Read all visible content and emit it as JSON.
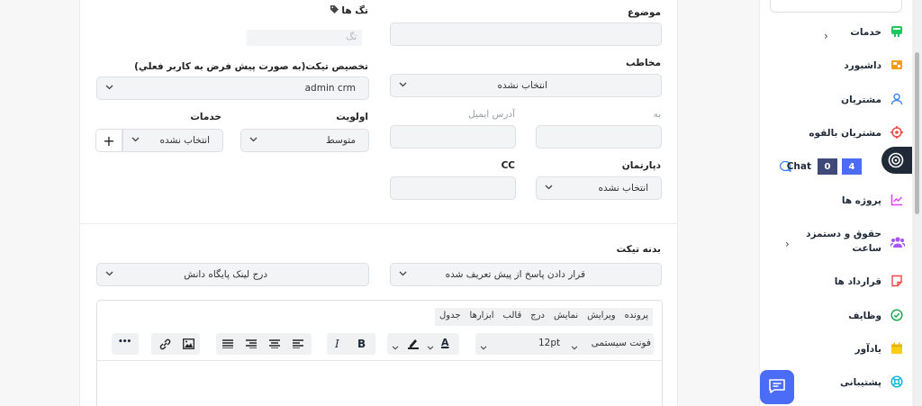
{
  "form": {
    "tags_label": "تگ ها",
    "tags_placeholder": "تگ",
    "subject_label": "موضوع",
    "subject_value": "",
    "assign_label": "تخصیص تیکت(به صورت پیش فرض به کاربر فعلي)",
    "assign_value": "admin crm",
    "contact_label": "مخاطب",
    "contact_value": "انتخاب نشده",
    "priority_label": "اولویت",
    "priority_value": "متوسط",
    "services_label": "خدمات",
    "services_value": "انتخاب نشده",
    "add_symbol": "+",
    "to_label": "به",
    "email_label": "آدرس ایمیل",
    "department_label": "دپارتمان",
    "department_value": "انتخاب نشده",
    "cc_label": "CC",
    "body_label": "بدنه تیکت",
    "predefined_reply_value": "قرار دادن پاسخ از پیش تعریف شده",
    "kb_link_value": "درج لینک پایگاه دانش"
  },
  "editor": {
    "menus": [
      "پرونده",
      "ویرایش",
      "نمایش",
      "درج",
      "قالب",
      "ابزارها",
      "جدول"
    ],
    "font_family": "فونت سیستمی",
    "font_size": "12pt",
    "bold": "B",
    "italic": "I",
    "text_color_letter": "A",
    "more": "•••"
  },
  "sidebar": {
    "items": [
      {
        "label": "خدمات",
        "icon": "services-icon",
        "arrow": "›"
      },
      {
        "label": "داشبورد",
        "icon": "dashboard-icon"
      },
      {
        "label": "مشتریان",
        "icon": "user-icon"
      },
      {
        "label": "مشتریان بالقوه",
        "icon": "target-icon"
      },
      {
        "label": "Chat",
        "icon": "chat-bubble-icon"
      },
      {
        "label": "پروژه ها",
        "icon": "chart-icon"
      },
      {
        "label": "حقوق و دستمزد",
        "label2": "ساعت",
        "icon": "people-icon",
        "arrow": "›"
      },
      {
        "label": "قرارداد ها",
        "icon": "contract-icon"
      },
      {
        "label": "وظایف",
        "icon": "check-circle-icon"
      },
      {
        "label": "یادآور",
        "icon": "calendar-icon"
      },
      {
        "label": "پشتیبانی",
        "icon": "lifebuoy-icon"
      }
    ],
    "chat_badges": [
      "0",
      "4"
    ]
  },
  "colors": {
    "accent": "#4b6cf7",
    "badge_dark": "#3f4a7a",
    "badge_blue": "#4b6cf7"
  }
}
